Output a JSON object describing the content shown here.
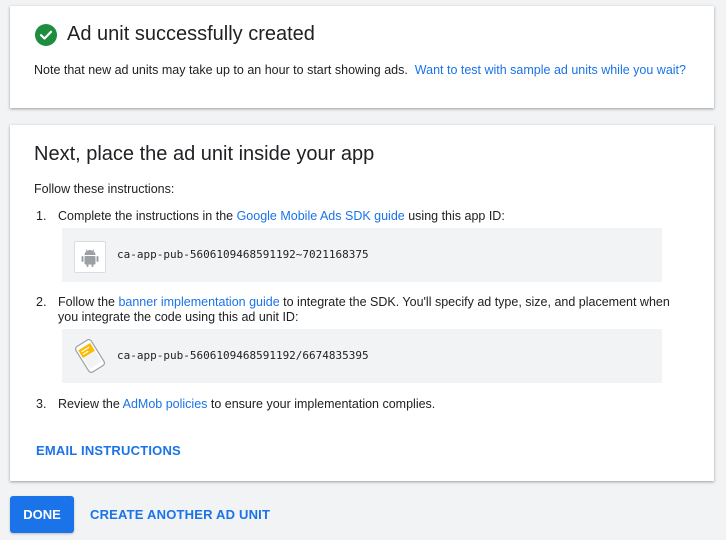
{
  "success": {
    "title": "Ad unit successfully created",
    "note": "Note that new ad units may take up to an hour to start showing ads.",
    "test_link": "Want to test with sample ad units while you wait?"
  },
  "placement": {
    "title": "Next, place the ad unit inside your app",
    "follow": "Follow these instructions:",
    "steps": [
      {
        "num": "1.",
        "pre": "Complete the instructions in the ",
        "link": "Google Mobile Ads SDK guide",
        "post": " using this app ID:",
        "code": "ca-app-pub-5606109468591192~7021168375",
        "icon": "android-icon"
      },
      {
        "num": "2.",
        "pre": "Follow the ",
        "link": "banner implementation guide",
        "post": " to integrate the SDK. You'll specify ad type, size, and placement when you integrate the code using this ad unit ID:",
        "code": "ca-app-pub-5606109468591192/6674835395",
        "icon": "banner-icon"
      },
      {
        "num": "3.",
        "pre": "Review the ",
        "link": "AdMob policies",
        "post": " to ensure your implementation complies."
      }
    ],
    "email_instructions": "EMAIL INSTRUCTIONS"
  },
  "footer": {
    "done": "DONE",
    "create_another": "CREATE ANOTHER AD UNIT"
  },
  "colors": {
    "accent": "#1a73e8",
    "success": "#1e8e3e",
    "background": "#f1f3f4"
  }
}
